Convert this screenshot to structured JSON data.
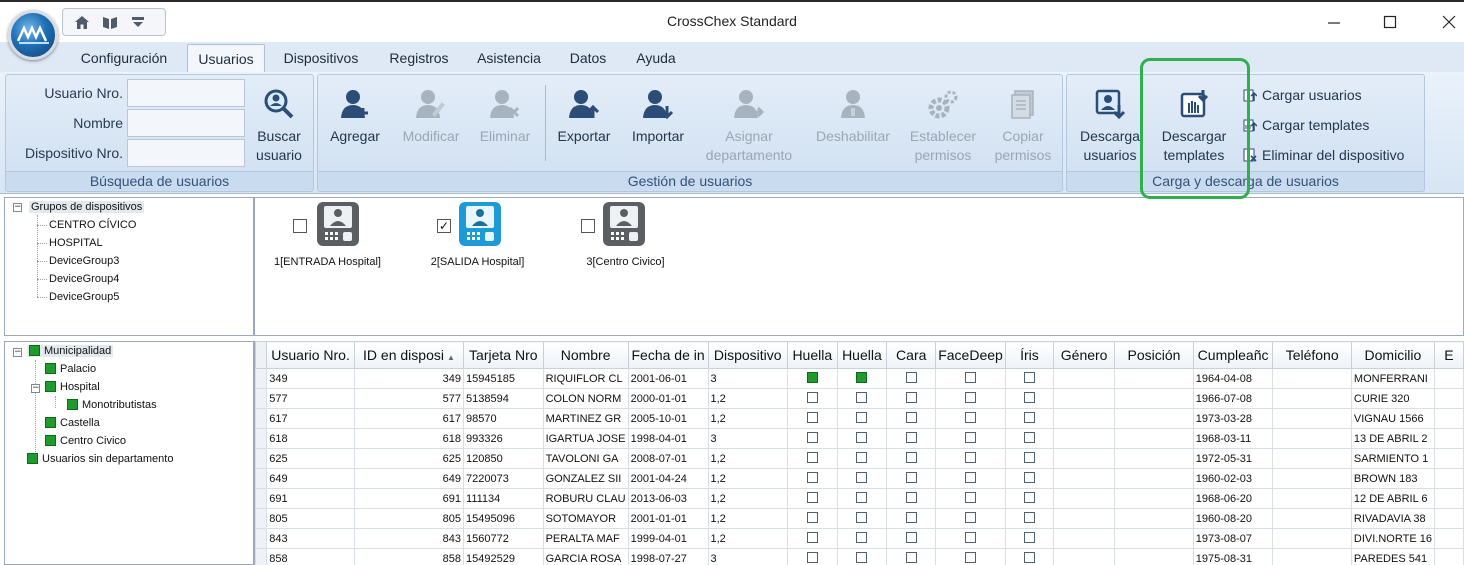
{
  "window": {
    "title": "CrossChex Standard"
  },
  "menu": {
    "tabs": [
      {
        "label": "Configuración"
      },
      {
        "label": "Usuarios",
        "active": true
      },
      {
        "label": "Dispositivos"
      },
      {
        "label": "Registros"
      },
      {
        "label": "Asistencia"
      },
      {
        "label": "Datos"
      },
      {
        "label": "Ayuda"
      }
    ]
  },
  "ribbon": {
    "search": {
      "label_user_no": "Usuario Nro.",
      "label_name": "Nombre",
      "label_device_no": "Dispositivo Nro.",
      "button_line1": "Buscar",
      "button_line2": "usuario",
      "group_label": "Búsqueda de usuarios"
    },
    "management": {
      "group_label": "Gestión de usuarios",
      "add": "Agregar",
      "modify": "Modificar",
      "delete": "Eliminar",
      "export": "Exportar",
      "import": "Importar",
      "assign_line1": "Asignar",
      "assign_line2": "departamento",
      "disable": "Deshabilitar",
      "perm_line1": "Establecer",
      "perm_line2": "permisos",
      "copy_line1": "Copiar",
      "copy_line2": "permisos"
    },
    "transfer": {
      "group_label": "Carga y descarga de usuarios",
      "download_users_line1": "Descarga",
      "download_users_line2": "usuarios",
      "download_templates_line1": "Descargar",
      "download_templates_line2": "templates",
      "upload_users": "Cargar usuarios",
      "upload_templates": "Cargar templates",
      "delete_from_device": "Eliminar del dispositivo"
    }
  },
  "device_tree": {
    "root": "Grupos de dispositivos",
    "items": [
      "CENTRO CÍVICO",
      "HOSPITAL",
      "DeviceGroup3",
      "DeviceGroup4",
      "DeviceGroup5"
    ]
  },
  "devices": [
    {
      "label": "1[ENTRADA Hospital]",
      "checked": false,
      "active": false
    },
    {
      "label": "2[SALIDA Hospital]",
      "checked": true,
      "active": true
    },
    {
      "label": "3[Centro Civico]",
      "checked": false,
      "active": false
    }
  ],
  "dept_tree": {
    "root": "Municipalidad",
    "palacio": "Palacio",
    "hospital": "Hospital",
    "monotributistas": "Monotributistas",
    "castella": "Castella",
    "centro_civico": "Centro Civico",
    "sin_depto": "Usuarios sin departamento"
  },
  "grid": {
    "columns": [
      "Usuario Nro.",
      "ID en disposi",
      "Tarjeta Nro",
      "Nombre",
      "Fecha de in",
      "Dispositivo",
      "Huella",
      "Huella",
      "Cara",
      "FaceDeep",
      "Íris",
      "Género",
      "Posición",
      "Cumpleañc",
      "Teléfono",
      "Domicilio",
      "E"
    ],
    "rows": [
      {
        "user": "349",
        "id": "349",
        "card": "15945185",
        "name": "RIQUIFLOR CL",
        "date": "2001-06-01",
        "device": "3",
        "h1": true,
        "h2": true,
        "birthday": "1964-04-08",
        "address": "MONFERRANI"
      },
      {
        "user": "577",
        "id": "577",
        "card": "5138594",
        "name": "COLON NORM",
        "date": "2000-01-01",
        "device": "1,2",
        "h1": false,
        "h2": false,
        "birthday": "1966-07-08",
        "address": "CURIE 320"
      },
      {
        "user": "617",
        "id": "617",
        "card": "98570",
        "name": "MARTINEZ GR",
        "date": "2005-10-01",
        "device": "1,2",
        "h1": false,
        "h2": false,
        "birthday": "1973-03-28",
        "address": "VIGNAU 1566"
      },
      {
        "user": "618",
        "id": "618",
        "card": "993326",
        "name": "IGARTUA JOSE",
        "date": "1998-04-01",
        "device": "3",
        "h1": false,
        "h2": false,
        "birthday": "1968-03-11",
        "address": "13 DE ABRIL 2"
      },
      {
        "user": "625",
        "id": "625",
        "card": "120850",
        "name": "TAVOLONI GA",
        "date": "2008-07-01",
        "device": "1,2",
        "h1": false,
        "h2": false,
        "birthday": "1972-05-31",
        "address": "SARMIENTO 1"
      },
      {
        "user": "649",
        "id": "649",
        "card": "7220073",
        "name": "GONZALEZ SII",
        "date": "2001-04-24",
        "device": "1,2",
        "h1": false,
        "h2": false,
        "birthday": "1960-02-03",
        "address": "BROWN 183"
      },
      {
        "user": "691",
        "id": "691",
        "card": "111134",
        "name": "ROBURU CLAU",
        "date": "2013-06-03",
        "device": "1,2",
        "h1": false,
        "h2": false,
        "birthday": "1968-06-20",
        "address": "12 DE ABRIL 6"
      },
      {
        "user": "805",
        "id": "805",
        "card": "15495096",
        "name": "SOTOMAYOR",
        "date": "2001-01-01",
        "device": "1,2",
        "h1": false,
        "h2": false,
        "birthday": "1960-08-20",
        "address": "RIVADAVIA 38"
      },
      {
        "user": "843",
        "id": "843",
        "card": "1560772",
        "name": "PERALTA MAF",
        "date": "1999-04-01",
        "device": "1,2",
        "h1": false,
        "h2": false,
        "birthday": "1973-08-07",
        "address": "DIVI.NORTE 16"
      },
      {
        "user": "858",
        "id": "858",
        "card": "15492529",
        "name": "GARCIA ROSA",
        "date": "1998-07-27",
        "device": "3",
        "h1": false,
        "h2": false,
        "birthday": "1975-08-31",
        "address": "PAREDES 541"
      }
    ]
  }
}
